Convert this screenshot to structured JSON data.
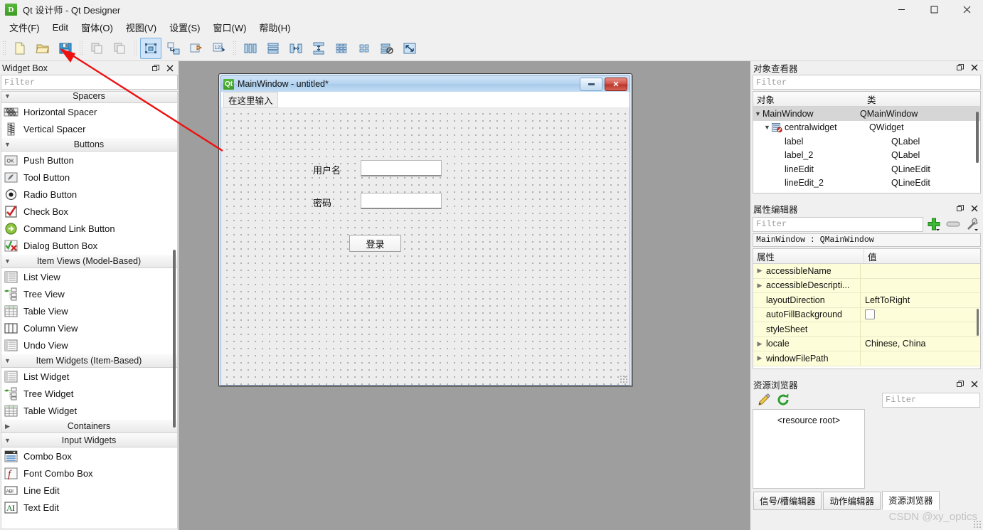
{
  "window": {
    "title": "Qt 设计师 - Qt Designer",
    "app_icon": "D",
    "controls": {
      "minimize": "minimize-icon",
      "maximize": "maximize-icon",
      "close": "close-icon"
    }
  },
  "menubar": {
    "items": [
      {
        "label": "文件(F)"
      },
      {
        "label": "Edit"
      },
      {
        "label": "窗体(O)"
      },
      {
        "label": "视图(V)"
      },
      {
        "label": "设置(S)"
      },
      {
        "label": "窗口(W)"
      },
      {
        "label": "帮助(H)"
      }
    ]
  },
  "toolbar": {
    "groups": [
      {
        "buttons": [
          {
            "name": "new-form-icon"
          },
          {
            "name": "open-form-icon"
          },
          {
            "name": "save-form-icon"
          }
        ]
      },
      {
        "buttons": [
          {
            "name": "copy-icon"
          },
          {
            "name": "paste-icon"
          }
        ]
      },
      {
        "buttons": [
          {
            "name": "edit-widgets-icon",
            "checked": true
          },
          {
            "name": "edit-signals-slots-icon"
          },
          {
            "name": "edit-buddies-icon"
          },
          {
            "name": "edit-tab-order-icon"
          }
        ]
      },
      {
        "buttons": [
          {
            "name": "layout-horizontally-icon"
          },
          {
            "name": "layout-vertically-icon"
          },
          {
            "name": "layout-splitter-horizontal-icon"
          },
          {
            "name": "layout-splitter-vertical-icon"
          },
          {
            "name": "layout-grid-icon"
          },
          {
            "name": "layout-form-icon"
          },
          {
            "name": "break-layout-icon"
          },
          {
            "name": "adjust-size-icon"
          }
        ]
      }
    ]
  },
  "widget_box": {
    "title": "Widget Box",
    "float_button": "float-icon",
    "close_button": "close-icon",
    "filter_placeholder": "Filter",
    "scrollbar": "vertical-scrollbar",
    "sections": [
      {
        "label": "Spacers",
        "expanded": true,
        "items": [
          {
            "label": "Horizontal Spacer",
            "icon": "horizontal-spacer-icon"
          },
          {
            "label": "Vertical Spacer",
            "icon": "vertical-spacer-icon"
          }
        ]
      },
      {
        "label": "Buttons",
        "expanded": true,
        "items": [
          {
            "label": "Push Button",
            "icon": "push-button-icon"
          },
          {
            "label": "Tool Button",
            "icon": "tool-button-icon"
          },
          {
            "label": "Radio Button",
            "icon": "radio-button-icon"
          },
          {
            "label": "Check Box",
            "icon": "check-box-icon"
          },
          {
            "label": "Command Link Button",
            "icon": "command-link-button-icon"
          },
          {
            "label": "Dialog Button Box",
            "icon": "dialog-button-box-icon"
          }
        ]
      },
      {
        "label": "Item Views (Model-Based)",
        "expanded": true,
        "items": [
          {
            "label": "List View",
            "icon": "list-view-icon"
          },
          {
            "label": "Tree View",
            "icon": "tree-view-icon"
          },
          {
            "label": "Table View",
            "icon": "table-view-icon"
          },
          {
            "label": "Column View",
            "icon": "column-view-icon"
          },
          {
            "label": "Undo View",
            "icon": "undo-view-icon"
          }
        ]
      },
      {
        "label": "Item Widgets (Item-Based)",
        "expanded": true,
        "items": [
          {
            "label": "List Widget",
            "icon": "list-widget-icon"
          },
          {
            "label": "Tree Widget",
            "icon": "tree-widget-icon"
          },
          {
            "label": "Table Widget",
            "icon": "table-widget-icon"
          }
        ]
      },
      {
        "label": "Containers",
        "expanded": false,
        "items": []
      },
      {
        "label": "Input Widgets",
        "expanded": true,
        "items": [
          {
            "label": "Combo Box",
            "icon": "combo-box-icon"
          },
          {
            "label": "Font Combo Box",
            "icon": "font-combo-box-icon"
          },
          {
            "label": "Line Edit",
            "icon": "line-edit-icon"
          },
          {
            "label": "Text Edit",
            "icon": "text-edit-icon"
          }
        ]
      }
    ]
  },
  "form": {
    "title": "MainWindow - untitled*",
    "qt_logo": "Qt",
    "minimize_button": "minimize-icon",
    "close_button": "close-icon",
    "menu_hint": "在这里输入",
    "widgets": {
      "label_username": "用户名",
      "label_password": "密码",
      "lineedit_username_value": "",
      "lineedit_password_value": "",
      "login_button": "登录"
    }
  },
  "object_inspector": {
    "title": "对象查看器",
    "float_button": "float-icon",
    "close_button": "close-icon",
    "filter_placeholder": "Filter",
    "columns": [
      "对象",
      "类"
    ],
    "rows": [
      {
        "name": "MainWindow",
        "class": "QMainWindow",
        "indent": 0,
        "chevron": "chevron-down-icon",
        "selected": true,
        "icon": ""
      },
      {
        "name": "centralwidget",
        "class": "QWidget",
        "indent": 1,
        "chevron": "chevron-down-icon",
        "selected": false,
        "icon": "widget-no-layout-icon"
      },
      {
        "name": "label",
        "class": "QLabel",
        "indent": 2,
        "chevron": "",
        "selected": false,
        "icon": ""
      },
      {
        "name": "label_2",
        "class": "QLabel",
        "indent": 2,
        "chevron": "",
        "selected": false,
        "icon": ""
      },
      {
        "name": "lineEdit",
        "class": "QLineEdit",
        "indent": 2,
        "chevron": "",
        "selected": false,
        "icon": ""
      },
      {
        "name": "lineEdit_2",
        "class": "QLineEdit",
        "indent": 2,
        "chevron": "",
        "selected": false,
        "icon": ""
      }
    ]
  },
  "property_editor": {
    "title": "属性编辑器",
    "float_button": "float-icon",
    "close_button": "close-icon",
    "filter_placeholder": "Filter",
    "add_button": "add-icon",
    "remove_button": "remove-icon",
    "configure_button": "wrench-icon",
    "object_line": "MainWindow : QMainWindow",
    "columns": [
      "属性",
      "值"
    ],
    "rows": [
      {
        "key": "accessibleName",
        "value": "",
        "expandable": true,
        "type": "text"
      },
      {
        "key": "accessibleDescripti...",
        "value": "",
        "expandable": true,
        "type": "text"
      },
      {
        "key": "layoutDirection",
        "value": "LeftToRight",
        "expandable": false,
        "type": "text"
      },
      {
        "key": "autoFillBackground",
        "value": "",
        "expandable": false,
        "type": "checkbox"
      },
      {
        "key": "styleSheet",
        "value": "",
        "expandable": false,
        "type": "text"
      },
      {
        "key": "locale",
        "value": "Chinese, China",
        "expandable": true,
        "type": "text"
      },
      {
        "key": "windowFilePath",
        "value": "",
        "expandable": true,
        "type": "text"
      }
    ]
  },
  "resource_browser": {
    "title": "资源浏览器",
    "float_button": "float-icon",
    "close_button": "close-icon",
    "edit_button": "pencil-icon",
    "reload_button": "reload-icon",
    "filter_placeholder": "Filter",
    "root_label": "<resource root>"
  },
  "bottom_tabs": {
    "tabs": [
      {
        "label": "信号/槽编辑器",
        "active": false
      },
      {
        "label": "动作编辑器",
        "active": false
      },
      {
        "label": "资源浏览器",
        "active": true
      }
    ]
  },
  "watermark": "CSDN @xy_optics",
  "colors": {
    "accent_blue": "#3a6ea5",
    "annotation_red": "#ee1111",
    "panel_bg": "#f0f0f0",
    "canvas_bg": "#9e9e9e",
    "property_row_bg": "#fdfdd9"
  }
}
